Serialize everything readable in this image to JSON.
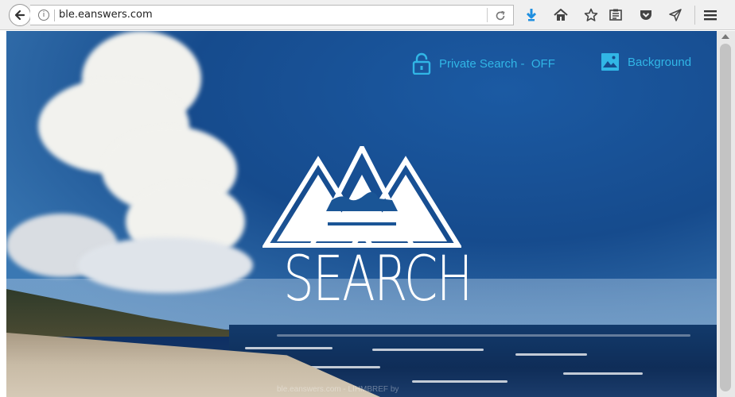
{
  "browser": {
    "url": "ble.eanswers.com",
    "icons": {
      "back": "back-arrow-icon",
      "info": "info-icon",
      "reload": "reload-icon",
      "download": "download-arrow-icon",
      "home": "home-icon",
      "bookmark": "star-icon",
      "reading_list": "reading-list-icon",
      "pocket": "pocket-icon",
      "send": "send-icon",
      "menu": "hamburger-menu-icon"
    },
    "info_glyph": "i"
  },
  "page": {
    "private_search_label": "Private Search -  OFF",
    "background_label": "Background",
    "logo_text": "SEARCH",
    "footer_text": "ble.eanswers.com - LIHMBREF by",
    "accent_color": "#31b6e6"
  }
}
